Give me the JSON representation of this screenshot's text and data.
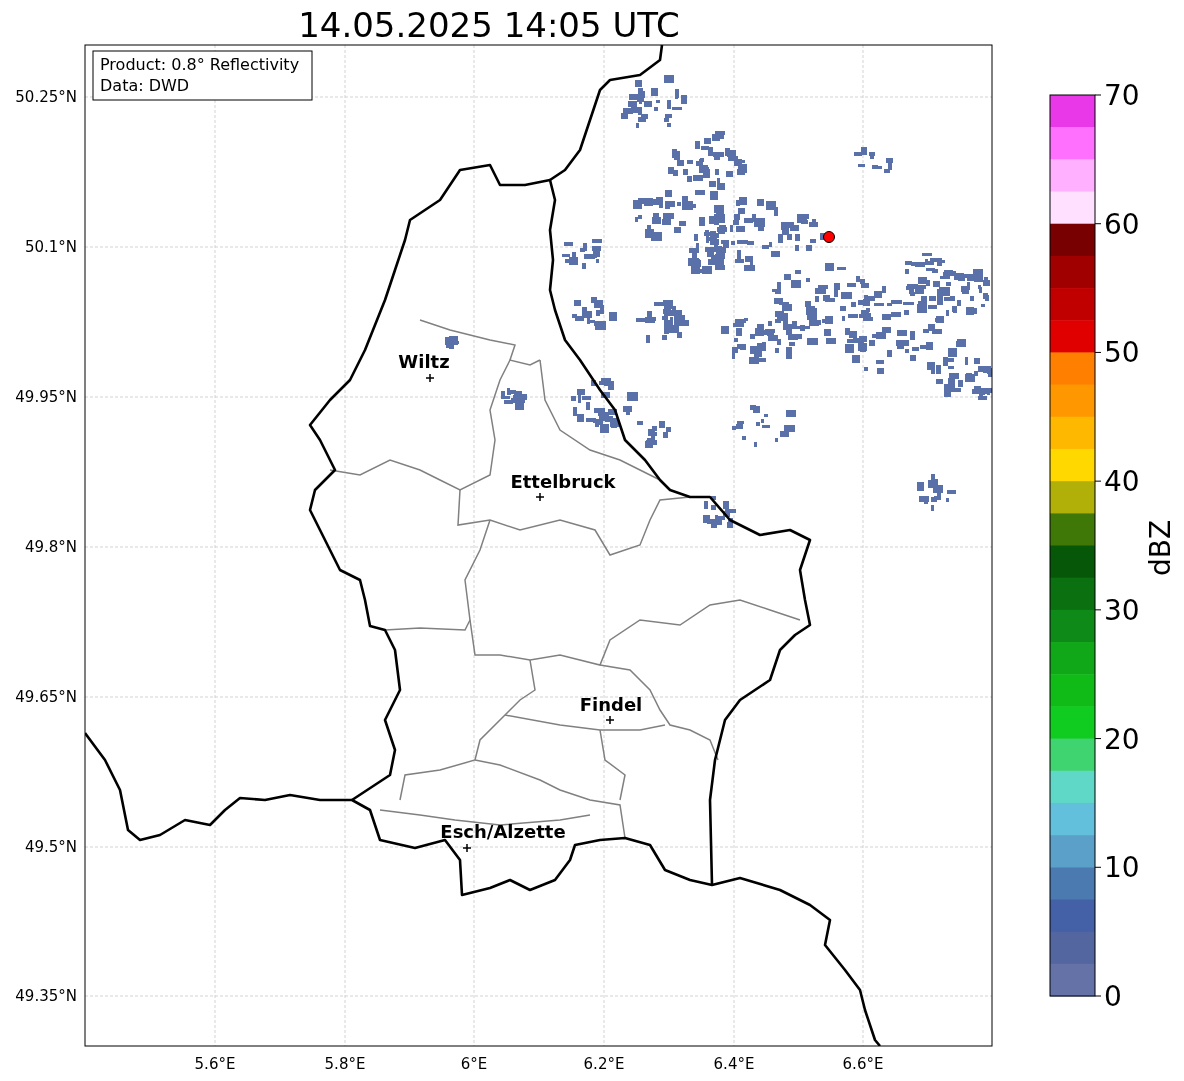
{
  "title": "14.05.2025 14:05 UTC",
  "legend": {
    "lines": [
      "Product: 0.8° Reflectivity",
      "Data: DWD"
    ]
  },
  "lat_ticks": [
    "50.25°N",
    "50.1°N",
    "49.95°N",
    "49.8°N",
    "49.65°N",
    "49.5°N",
    "49.35°N"
  ],
  "lon_ticks": [
    "5.6°E",
    "5.8°E",
    "6°E",
    "6.2°E",
    "6.4°E",
    "6.6°E"
  ],
  "cities": [
    {
      "name": "Wiltz"
    },
    {
      "name": "Ettelbruck"
    },
    {
      "name": "Findel"
    },
    {
      "name": "Esch/Alzette"
    }
  ],
  "colorbar": {
    "label": "dBZ",
    "ticks": [
      "70",
      "60",
      "50",
      "40",
      "30",
      "20",
      "10",
      "0"
    ],
    "bands": [
      {
        "color": "#e838e8"
      },
      {
        "color": "#ff70ff"
      },
      {
        "color": "#ffb0ff"
      },
      {
        "color": "#ffe0ff"
      },
      {
        "color": "#780000"
      },
      {
        "color": "#a00000"
      },
      {
        "color": "#c00000"
      },
      {
        "color": "#e00000"
      },
      {
        "color": "#ff8000"
      },
      {
        "color": "#ff9800"
      },
      {
        "color": "#ffb800"
      },
      {
        "color": "#ffd800"
      },
      {
        "color": "#b0b008"
      },
      {
        "color": "#407808"
      },
      {
        "color": "#065808"
      },
      {
        "color": "#0a7010"
      },
      {
        "color": "#0e8a18"
      },
      {
        "color": "#10a818"
      },
      {
        "color": "#10bb18"
      },
      {
        "color": "#10cc20"
      },
      {
        "color": "#40d470"
      },
      {
        "color": "#60d8c8"
      },
      {
        "color": "#62c0dc"
      },
      {
        "color": "#5aa0c8"
      },
      {
        "color": "#4a7ab0"
      },
      {
        "color": "#4460a6"
      },
      {
        "color": "#5466a0"
      },
      {
        "color": "#6472a8"
      }
    ]
  }
}
